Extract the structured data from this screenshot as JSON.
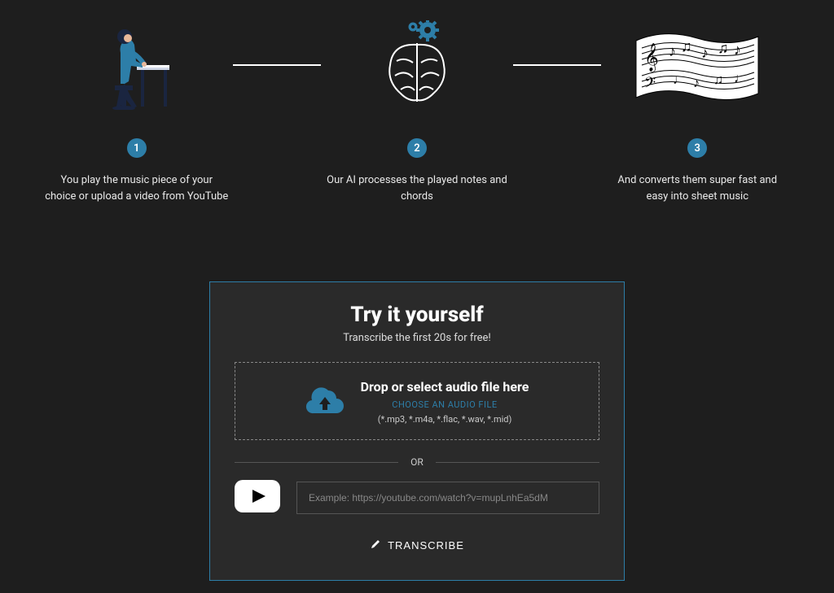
{
  "steps": [
    {
      "num": "1",
      "text": "You play the music piece of your choice or upload a video from YouTube"
    },
    {
      "num": "2",
      "text": "Our AI processes the played notes and chords"
    },
    {
      "num": "3",
      "text": "And converts them super fast and easy into sheet music"
    }
  ],
  "try": {
    "title": "Try it yourself",
    "subtitle": "Transcribe the first 20s for free!",
    "drop_heading": "Drop or select audio file here",
    "choose_label": "CHOOSE AN AUDIO FILE",
    "formats": "(*.mp3, *.m4a, *.flac, *.wav, *.mid)",
    "or_label": "OR",
    "yt_placeholder": "Example: https://youtube.com/watch?v=mupLnhEa5dM",
    "transcribe_label": "TRANSCRIBE"
  },
  "colors": {
    "accent": "#2d7ea8",
    "panel": "#2a2a2a",
    "bg": "#1e1e1e"
  }
}
